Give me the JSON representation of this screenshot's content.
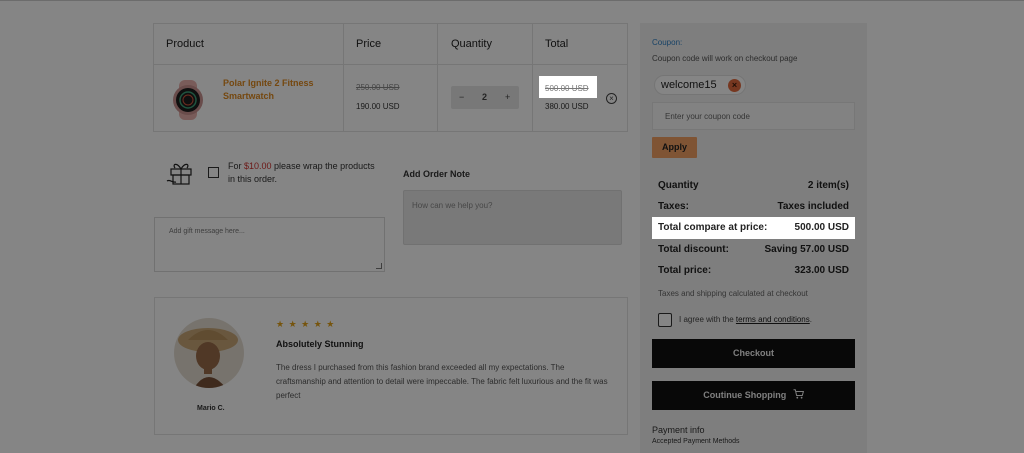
{
  "cart": {
    "headers": {
      "product": "Product",
      "price": "Price",
      "quantity": "Quantity",
      "total": "Total"
    },
    "item": {
      "name": "Polar Ignite 2 Fitness Smartwatch",
      "price_original": "250.00 USD",
      "price_sale": "190.00 USD",
      "quantity": "2",
      "total_original": "500.00 USD",
      "total_sale": "380.00 USD"
    }
  },
  "gift": {
    "text_before": "For ",
    "price": "$10.00",
    "text_after": " please wrap the products in this order.",
    "message_placeholder": "Add gift message here..."
  },
  "order_note": {
    "title": "Add Order Note",
    "placeholder": "How can we help you?"
  },
  "review": {
    "stars": "★ ★ ★ ★ ★",
    "title": "Absolutely Stunning",
    "body": "The dress I purchased from this fashion brand exceeded all my expectations. The craftsmanship and attention to detail were impeccable. The fabric felt luxurious and the fit was perfect",
    "author": "Mario C."
  },
  "sidebar": {
    "coupon_label": "Coupon:",
    "coupon_hint": "Coupon code will work on checkout page",
    "applied_code": "welcome15",
    "coupon_placeholder": "Enter your coupon code",
    "apply_label": "Apply",
    "summary": [
      {
        "label": "Quantity",
        "value": "2 item(s)"
      },
      {
        "label": "Taxes:",
        "value": "Taxes included"
      },
      {
        "label": "Total compare at price:",
        "value": "500.00 USD"
      },
      {
        "label": "Total discount:",
        "value": "Saving 57.00 USD"
      },
      {
        "label": "Total price:",
        "value": "323.00 USD"
      }
    ],
    "tax_note": "Taxes and shipping calculated at checkout",
    "agree_before": "I agree with the ",
    "agree_link": "terms and conditions",
    "agree_after": ".",
    "checkout_label": "Checkout",
    "continue_label": "Coutinue Shopping",
    "payment_info": "Payment info",
    "payment_methods": "Accepted Payment Methods"
  },
  "colors": {
    "accent_orange": "#e08a1f",
    "link_blue": "#2d7fc4",
    "apply_button": "#f4a265",
    "gift_price_red": "#d0312d"
  }
}
